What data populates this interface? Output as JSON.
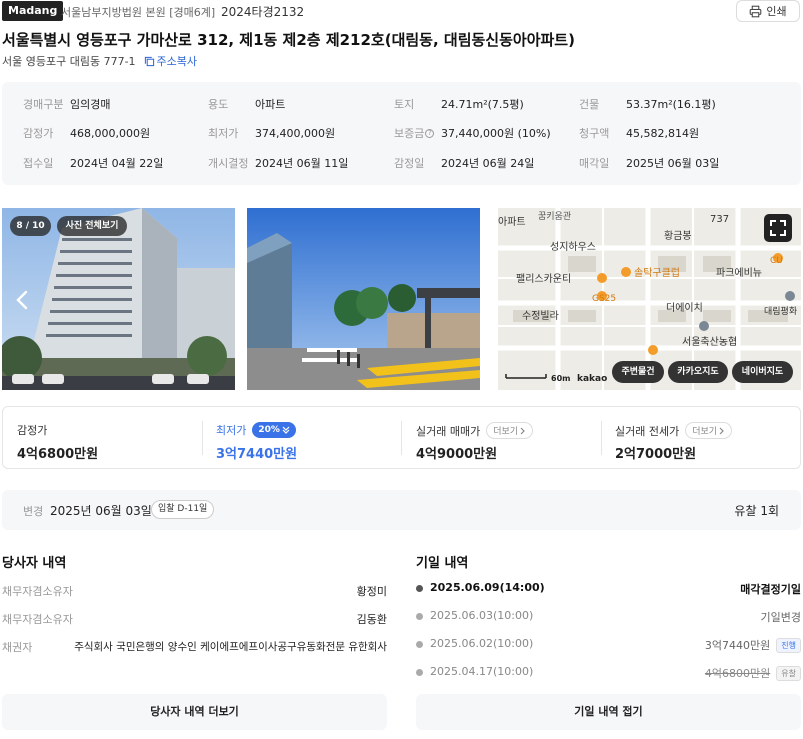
{
  "header": {
    "logo": "Madang",
    "court": "서울남부지방법원 본원 [경매6계]",
    "case_no": "2024타경2132",
    "print_label": "인쇄"
  },
  "title": "서울특별시 영등포구 가마산로 312, 제1동 제2층 제212호(대림동, 대림동신동아아파트)",
  "address": {
    "jibun": "서울 영등포구 대림동 777-1",
    "copy_label": "주소복사"
  },
  "info": [
    {
      "label": "경매구분",
      "value": "임의경매"
    },
    {
      "label": "용도",
      "value": "아파트"
    },
    {
      "label": "토지",
      "value": "24.71m²(7.5평)"
    },
    {
      "label": "건물",
      "value": "53.37m²(16.1평)"
    },
    {
      "label": "감정가",
      "value": "468,000,000원"
    },
    {
      "label": "최저가",
      "value": "374,400,000원"
    },
    {
      "label": "보증금",
      "value": "37,440,000원 (10%)"
    },
    {
      "label": "청구액",
      "value": "45,582,814원"
    },
    {
      "label": "접수일",
      "value": "2024년 04월 22일"
    },
    {
      "label": "개시결정",
      "value": "2024년 06월 11일"
    },
    {
      "label": "감정일",
      "value": "2024년 06월 24일"
    },
    {
      "label": "매각일",
      "value": "2025년 06월 03일"
    }
  ],
  "photos": {
    "counter": "8 / 10",
    "view_all": "사진 전체보기"
  },
  "map": {
    "labels": [
      "아파트",
      "꿈키움관",
      "성지하우스",
      "황금봉",
      "737",
      "팰리스카운티",
      "솔탁구클럽",
      "파크에비뉴",
      "GS25",
      "CU",
      "수정빌라",
      "더에이치",
      "대림평화",
      "서울축산농협"
    ],
    "scale": "60m",
    "brand": "kakao",
    "buttons": [
      "주변물건",
      "카카오지도",
      "네이버지도"
    ]
  },
  "prices": {
    "appraisal": {
      "label": "감정가",
      "value": "4억6800만원"
    },
    "minimum": {
      "label": "최저가",
      "pct": "20%",
      "value": "3억7440만원"
    },
    "trade": {
      "label": "실거래 매매가",
      "more": "더보기",
      "value": "4억9000만원"
    },
    "jeonse": {
      "label": "실거래 전세가",
      "more": "더보기",
      "value": "2억7000만원"
    }
  },
  "change": {
    "label": "변경",
    "date": "2025년 06월 03일",
    "dday": "입찰 D-11일",
    "fail_count": "유찰 1회"
  },
  "parties": {
    "title": "당사자 내역",
    "rows": [
      {
        "role": "채무자겸소유자",
        "name": "황정미"
      },
      {
        "role": "채무자겸소유자",
        "name": "김동환"
      },
      {
        "role": "채권자",
        "name": "주식회사 국민은행의 양수인 케이에프에프이사공구유동화전문 유한회사"
      }
    ],
    "more_label": "당사자 내역 더보기"
  },
  "schedule": {
    "title": "기일 내역",
    "rows": [
      {
        "date": "2025.06.09(14:00)",
        "result": "매각결정기일",
        "tag": ""
      },
      {
        "date": "2025.06.03(10:00)",
        "result": "기일변경",
        "tag": ""
      },
      {
        "date": "2025.06.02(10:00)",
        "result": "3억7440만원",
        "tag": "진행"
      },
      {
        "date": "2025.04.17(10:00)",
        "result": "4억6800만원",
        "tag": "유찰"
      }
    ],
    "collapse_label": "기일 내역 접기"
  },
  "colors": {
    "accent": "#3a73e8",
    "panel_bg": "#f6f7f9",
    "dark": "#222222"
  }
}
